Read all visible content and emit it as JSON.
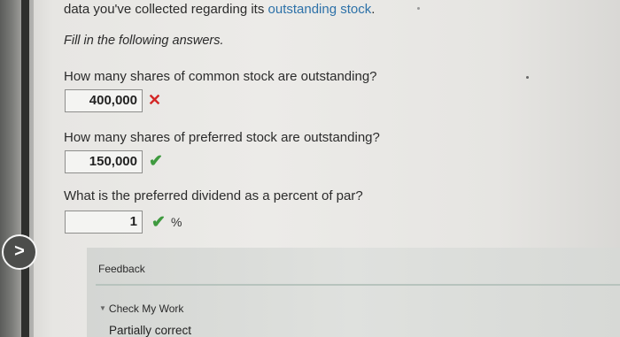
{
  "intro": {
    "text_before": "data you've collected regarding its ",
    "link_text": "outstanding stock",
    "text_after": "."
  },
  "instructions": "Fill in the following answers.",
  "questions": [
    {
      "prompt": "How many shares of common stock are outstanding?",
      "answer": "400,000",
      "status": "incorrect",
      "unit": ""
    },
    {
      "prompt": "How many shares of preferred stock are outstanding?",
      "answer": "150,000",
      "status": "correct",
      "unit": ""
    },
    {
      "prompt": "What is the preferred dividend as a percent of par?",
      "answer": "1",
      "status": "correct",
      "unit": "%"
    }
  ],
  "marks": {
    "incorrect": "✕",
    "correct": "✔"
  },
  "nav": {
    "next_glyph": ">"
  },
  "feedback": {
    "title": "Feedback",
    "toggle_glyph": "▼",
    "check_work_label": "Check My Work",
    "result": "Partially correct"
  },
  "colors": {
    "link": "#2d71a8",
    "incorrect": "#d32626",
    "correct": "#3f9a3f"
  }
}
